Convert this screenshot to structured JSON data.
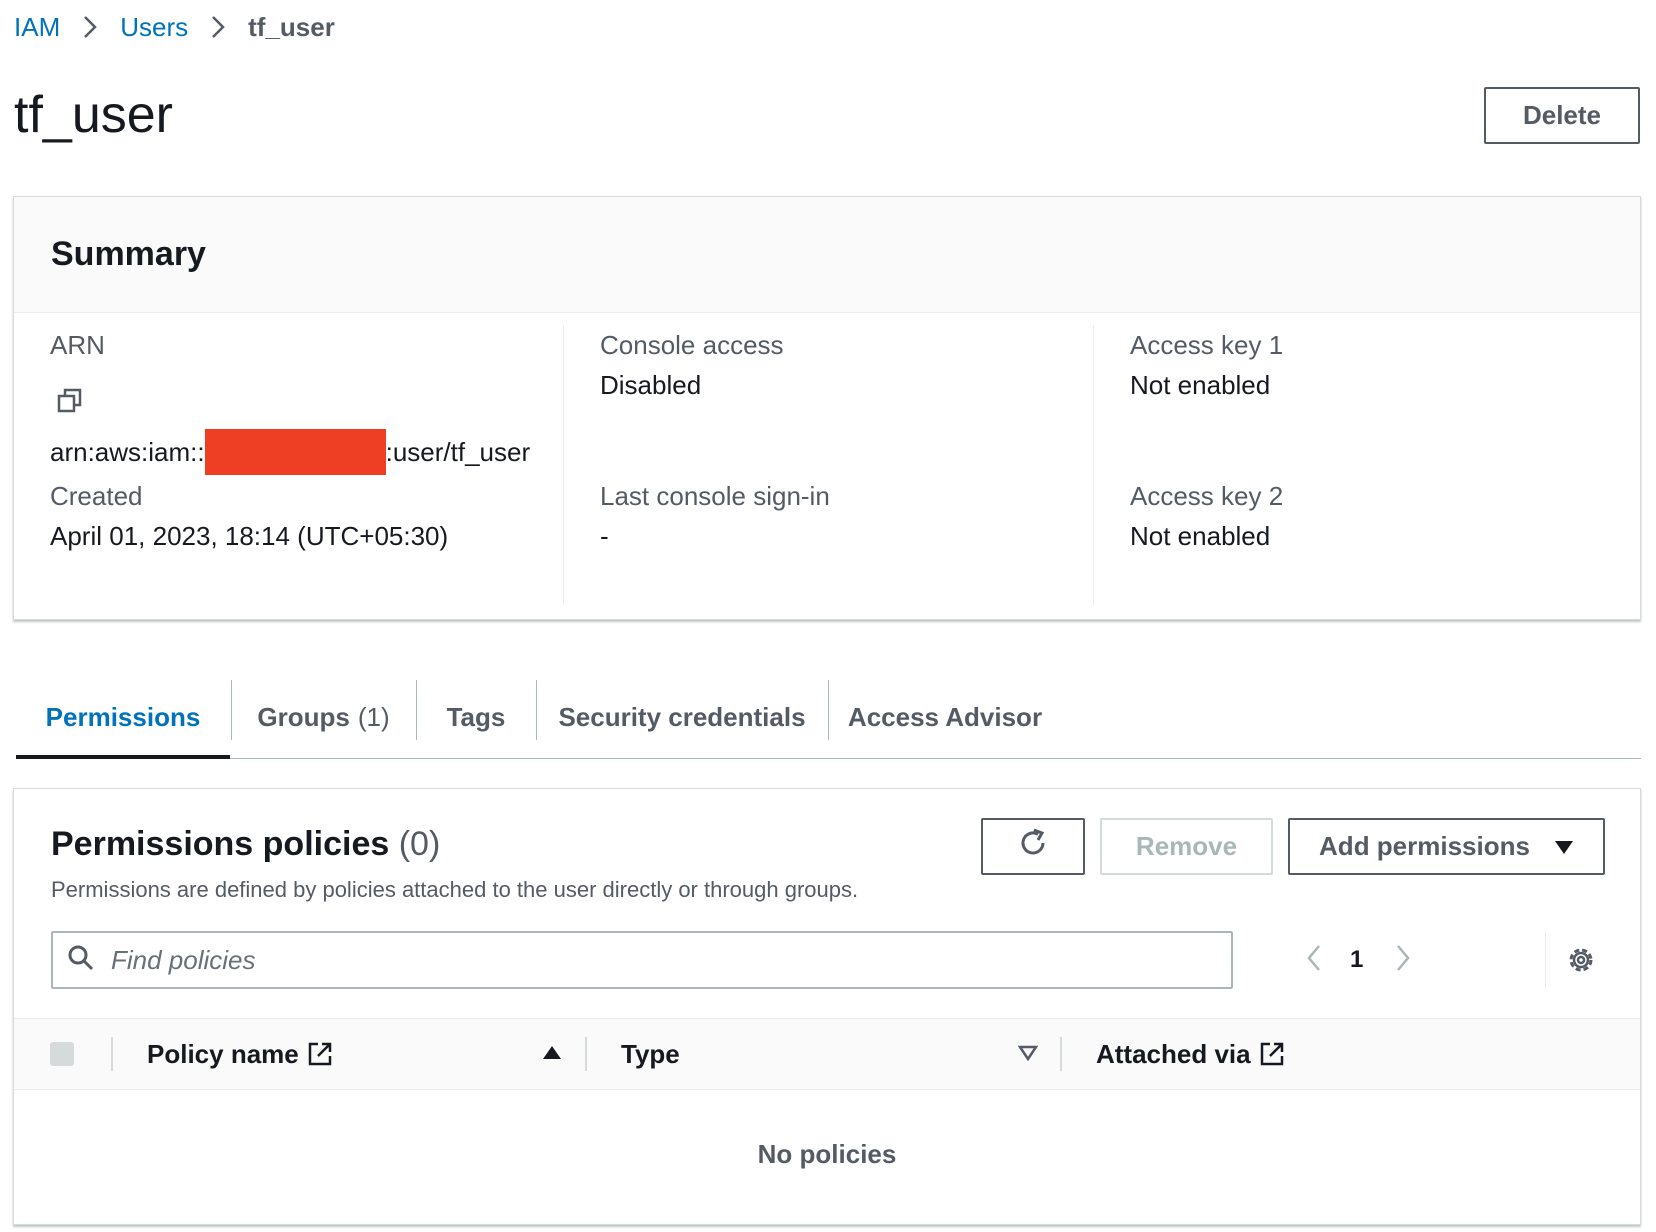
{
  "breadcrumb": {
    "items": [
      "IAM",
      "Users"
    ],
    "current": "tf_user"
  },
  "page": {
    "title": "tf_user",
    "delete_label": "Delete"
  },
  "summary": {
    "title": "Summary",
    "arn_label": "ARN",
    "arn_prefix": "arn:aws:iam::",
    "arn_suffix": ":user/tf_user",
    "created_label": "Created",
    "created_value": "April 01, 2023, 18:14 (UTC+05:30)",
    "console_access_label": "Console access",
    "console_access_value": "Disabled",
    "last_signin_label": "Last console sign-in",
    "last_signin_value": "-",
    "access_key1_label": "Access key 1",
    "access_key1_value": "Not enabled",
    "access_key2_label": "Access key 2",
    "access_key2_value": "Not enabled"
  },
  "tabs": [
    {
      "label": "Permissions",
      "count": ""
    },
    {
      "label": "Groups",
      "count": "(1)"
    },
    {
      "label": "Tags",
      "count": ""
    },
    {
      "label": "Security credentials",
      "count": ""
    },
    {
      "label": "Access Advisor",
      "count": ""
    }
  ],
  "permissions": {
    "title": "Permissions policies",
    "count": "(0)",
    "description": "Permissions are defined by policies attached to the user directly or through groups.",
    "remove_label": "Remove",
    "add_label": "Add permissions",
    "search_placeholder": "Find policies",
    "page_number": "1",
    "columns": [
      "Policy name",
      "Type",
      "Attached via"
    ],
    "empty_text": "No policies"
  },
  "colors": {
    "link": "#0073bb",
    "redaction": "#ee3f25",
    "text": "#16191f",
    "muted": "#545b64"
  }
}
